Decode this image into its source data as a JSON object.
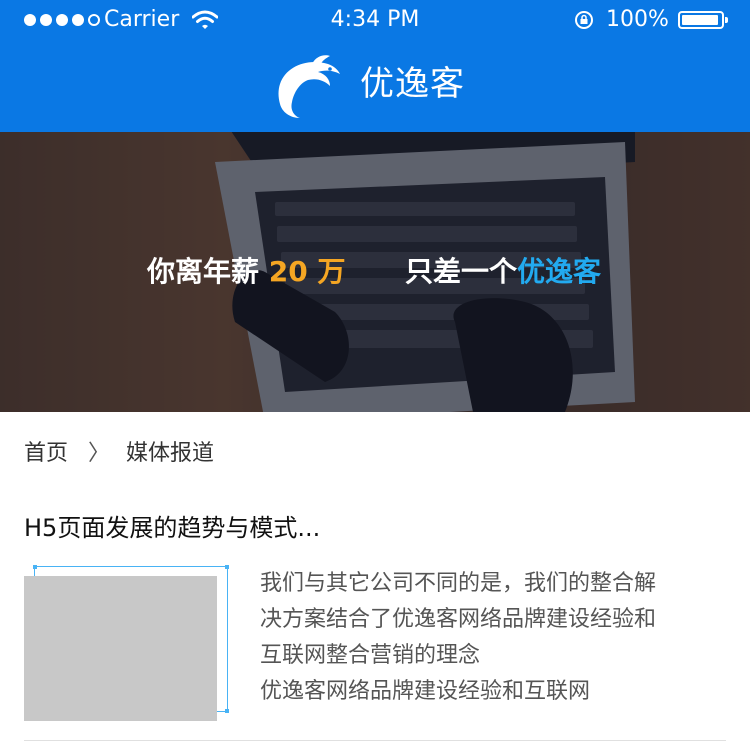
{
  "status_bar": {
    "carrier": "Carrier",
    "time": "4:34 PM",
    "battery": "100%",
    "icons": [
      "signal-dots-icon",
      "wifi-icon",
      "orientation-lock-icon",
      "battery-icon"
    ]
  },
  "header": {
    "brand": "优逸客",
    "logo_icon": "dolphin-logo-icon",
    "background_color": "#0a78e4"
  },
  "banner": {
    "text_part1": "你离年薪",
    "salary": "20 万",
    "text_part2": "只差一个",
    "brand_highlight": "优逸客",
    "salary_color": "#f5a623",
    "brand_color": "#22aaf0"
  },
  "breadcrumb": {
    "home": "首页",
    "separator": "〉",
    "current": "媒体报道"
  },
  "article": {
    "title": "H5页面发展的趋势与模式...",
    "excerpt_lines": [
      "我们与其它公司不同的是，我们的整合解",
      "决方案结合了优逸客网络品牌建设经验和",
      "互联网整合营销的理念",
      "优逸客网络品牌建设经验和互联网"
    ]
  }
}
